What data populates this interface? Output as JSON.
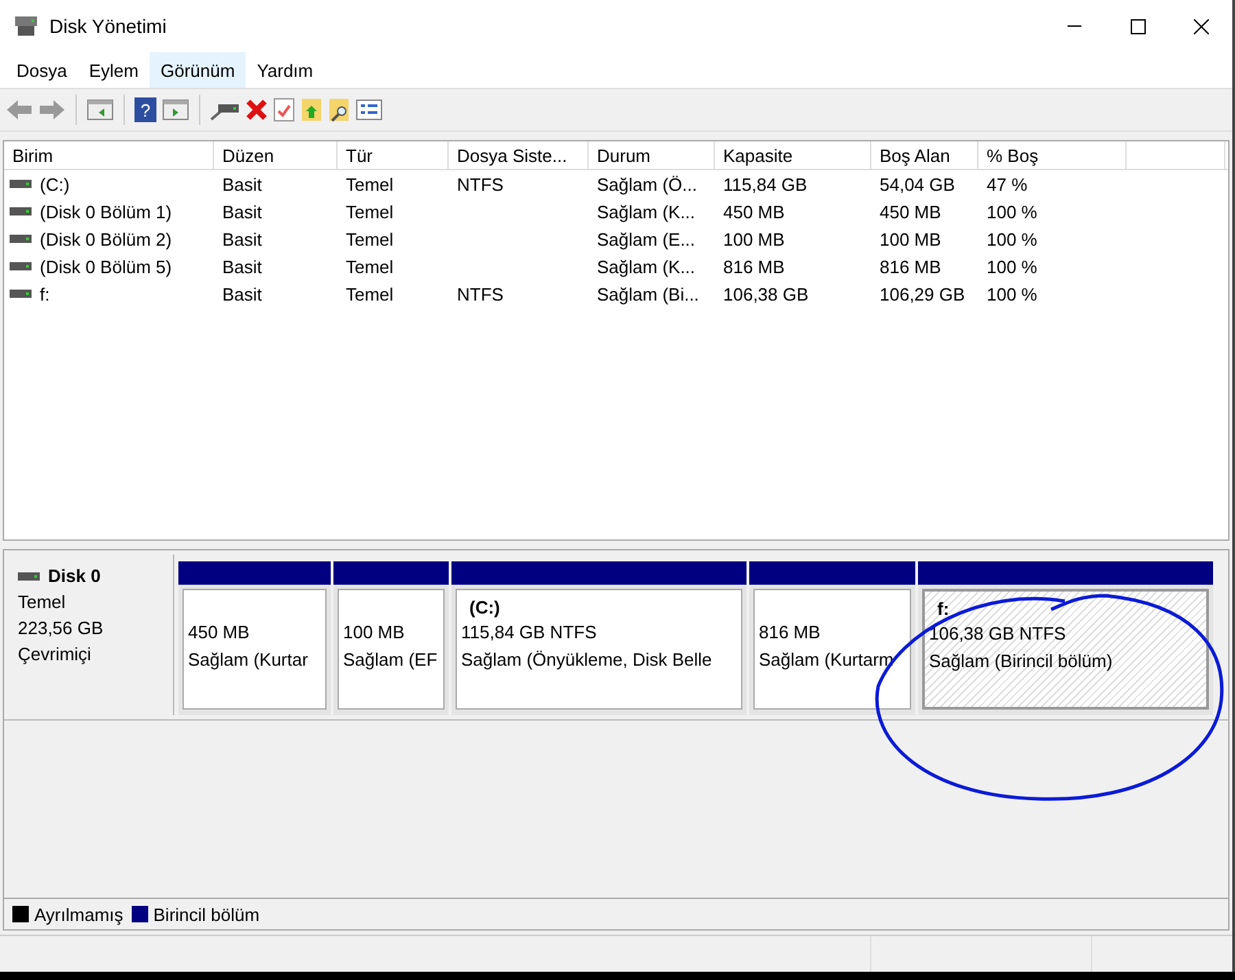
{
  "window": {
    "title": "Disk Yönetimi"
  },
  "toolbar": {
    "help_glyph": "?"
  },
  "menu": [
    {
      "label": "Dosya",
      "selected": false
    },
    {
      "label": "Eylem",
      "selected": false
    },
    {
      "label": "Görünüm",
      "selected": true
    },
    {
      "label": "Yardım",
      "selected": false
    }
  ],
  "table": {
    "columns": [
      "Birim",
      "Düzen",
      "Tür",
      "Dosya Siste...",
      "Durum",
      "Kapasite",
      "Boş Alan",
      "% Boş"
    ],
    "rows": [
      {
        "cells": [
          "(C:)",
          "Basit",
          "Temel",
          "NTFS",
          "Sağlam (Ö...",
          "115,84 GB",
          "54,04 GB",
          "47 %"
        ]
      },
      {
        "cells": [
          "(Disk 0 Bölüm 1)",
          "Basit",
          "Temel",
          "",
          "Sağlam (K...",
          "450 MB",
          "450 MB",
          "100 %"
        ]
      },
      {
        "cells": [
          "(Disk 0 Bölüm 2)",
          "Basit",
          "Temel",
          "",
          "Sağlam (E...",
          "100 MB",
          "100 MB",
          "100 %"
        ]
      },
      {
        "cells": [
          "(Disk 0 Bölüm 5)",
          "Basit",
          "Temel",
          "",
          "Sağlam (K...",
          "816 MB",
          "816 MB",
          "100 %"
        ]
      },
      {
        "cells": [
          "f:",
          "Basit",
          "Temel",
          "NTFS",
          "Sağlam (Bi...",
          "106,38 GB",
          "106,29 GB",
          "100 %"
        ]
      }
    ]
  },
  "disk": {
    "name": "Disk 0",
    "type": "Temel",
    "size": "223,56 GB",
    "status": "Çevrimiçi",
    "partitions": [
      {
        "size": "450 MB",
        "status": "Sağlam (Kurtar",
        "selected": false
      },
      {
        "size": "100 MB",
        "status": "Sağlam (EF",
        "selected": false
      },
      {
        "label": "(C:)",
        "size": "115,84 GB NTFS",
        "status": "Sağlam (Önyükleme, Disk Belle",
        "selected": false
      },
      {
        "size": "816 MB",
        "status": "Sağlam (Kurtarm",
        "selected": false
      },
      {
        "label": "f:",
        "size": "106,38 GB NTFS",
        "status": "Sağlam (Birincil bölüm)",
        "selected": true
      }
    ]
  },
  "legend": [
    {
      "label": "Ayrılmamış",
      "color": "#000000"
    },
    {
      "label": "Birincil bölüm",
      "color": "#000080"
    }
  ]
}
